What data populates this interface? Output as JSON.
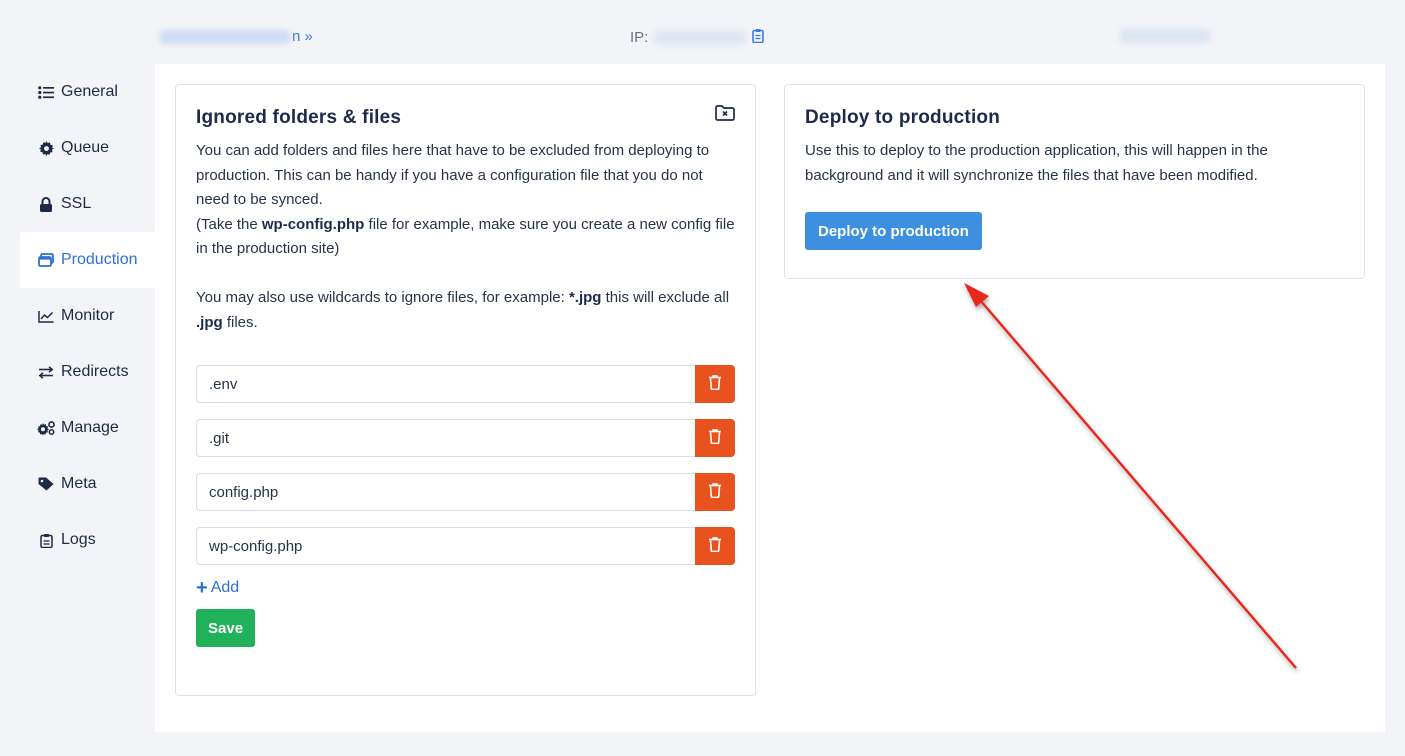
{
  "topbar": {
    "site_suffix": "n »",
    "ip_label": "IP:"
  },
  "sidebar": {
    "items": [
      {
        "label": "General",
        "icon": "list-icon"
      },
      {
        "label": "Queue",
        "icon": "gear-icon"
      },
      {
        "label": "SSL",
        "icon": "lock-icon"
      },
      {
        "label": "Production",
        "icon": "window-icon",
        "active": true
      },
      {
        "label": "Monitor",
        "icon": "chart-line-icon"
      },
      {
        "label": "Redirects",
        "icon": "swap-arrows-icon"
      },
      {
        "label": "Manage",
        "icon": "gears-icon"
      },
      {
        "label": "Meta",
        "icon": "tag-icon"
      },
      {
        "label": "Logs",
        "icon": "clipboard-icon"
      }
    ]
  },
  "ignored": {
    "title": "Ignored folders & files",
    "desc_1": "You can add folders and files here that have to be excluded from deploying to production. This can be handy if you have a configuration file that you do not need to be synced.",
    "desc_2_pre": "(Take the ",
    "desc_2_bold": "wp-config.php",
    "desc_2_post": " file for example, make sure you create a new config file in the production site)",
    "desc_3_pre": "You may also use wildcards to ignore files, for example: ",
    "desc_3_bold1": "*.jpg",
    "desc_3_mid": " this will exclude all ",
    "desc_3_bold2": ".jpg",
    "desc_3_post": " files.",
    "entries": [
      ".env",
      ".git",
      "config.php",
      "wp-config.php"
    ],
    "add_label": "Add",
    "save_label": "Save"
  },
  "deploy": {
    "title": "Deploy to production",
    "desc": "Use this to deploy to the production application, this will happen in the background and it will synchronize the files that have been modified.",
    "button_label": "Deploy to production"
  },
  "colors": {
    "accent": "#2f6fd6",
    "danger": "#e8521e",
    "success": "#1fb25a",
    "deploy_button": "#3d8fe0",
    "annotation_arrow": "#e8261c"
  }
}
